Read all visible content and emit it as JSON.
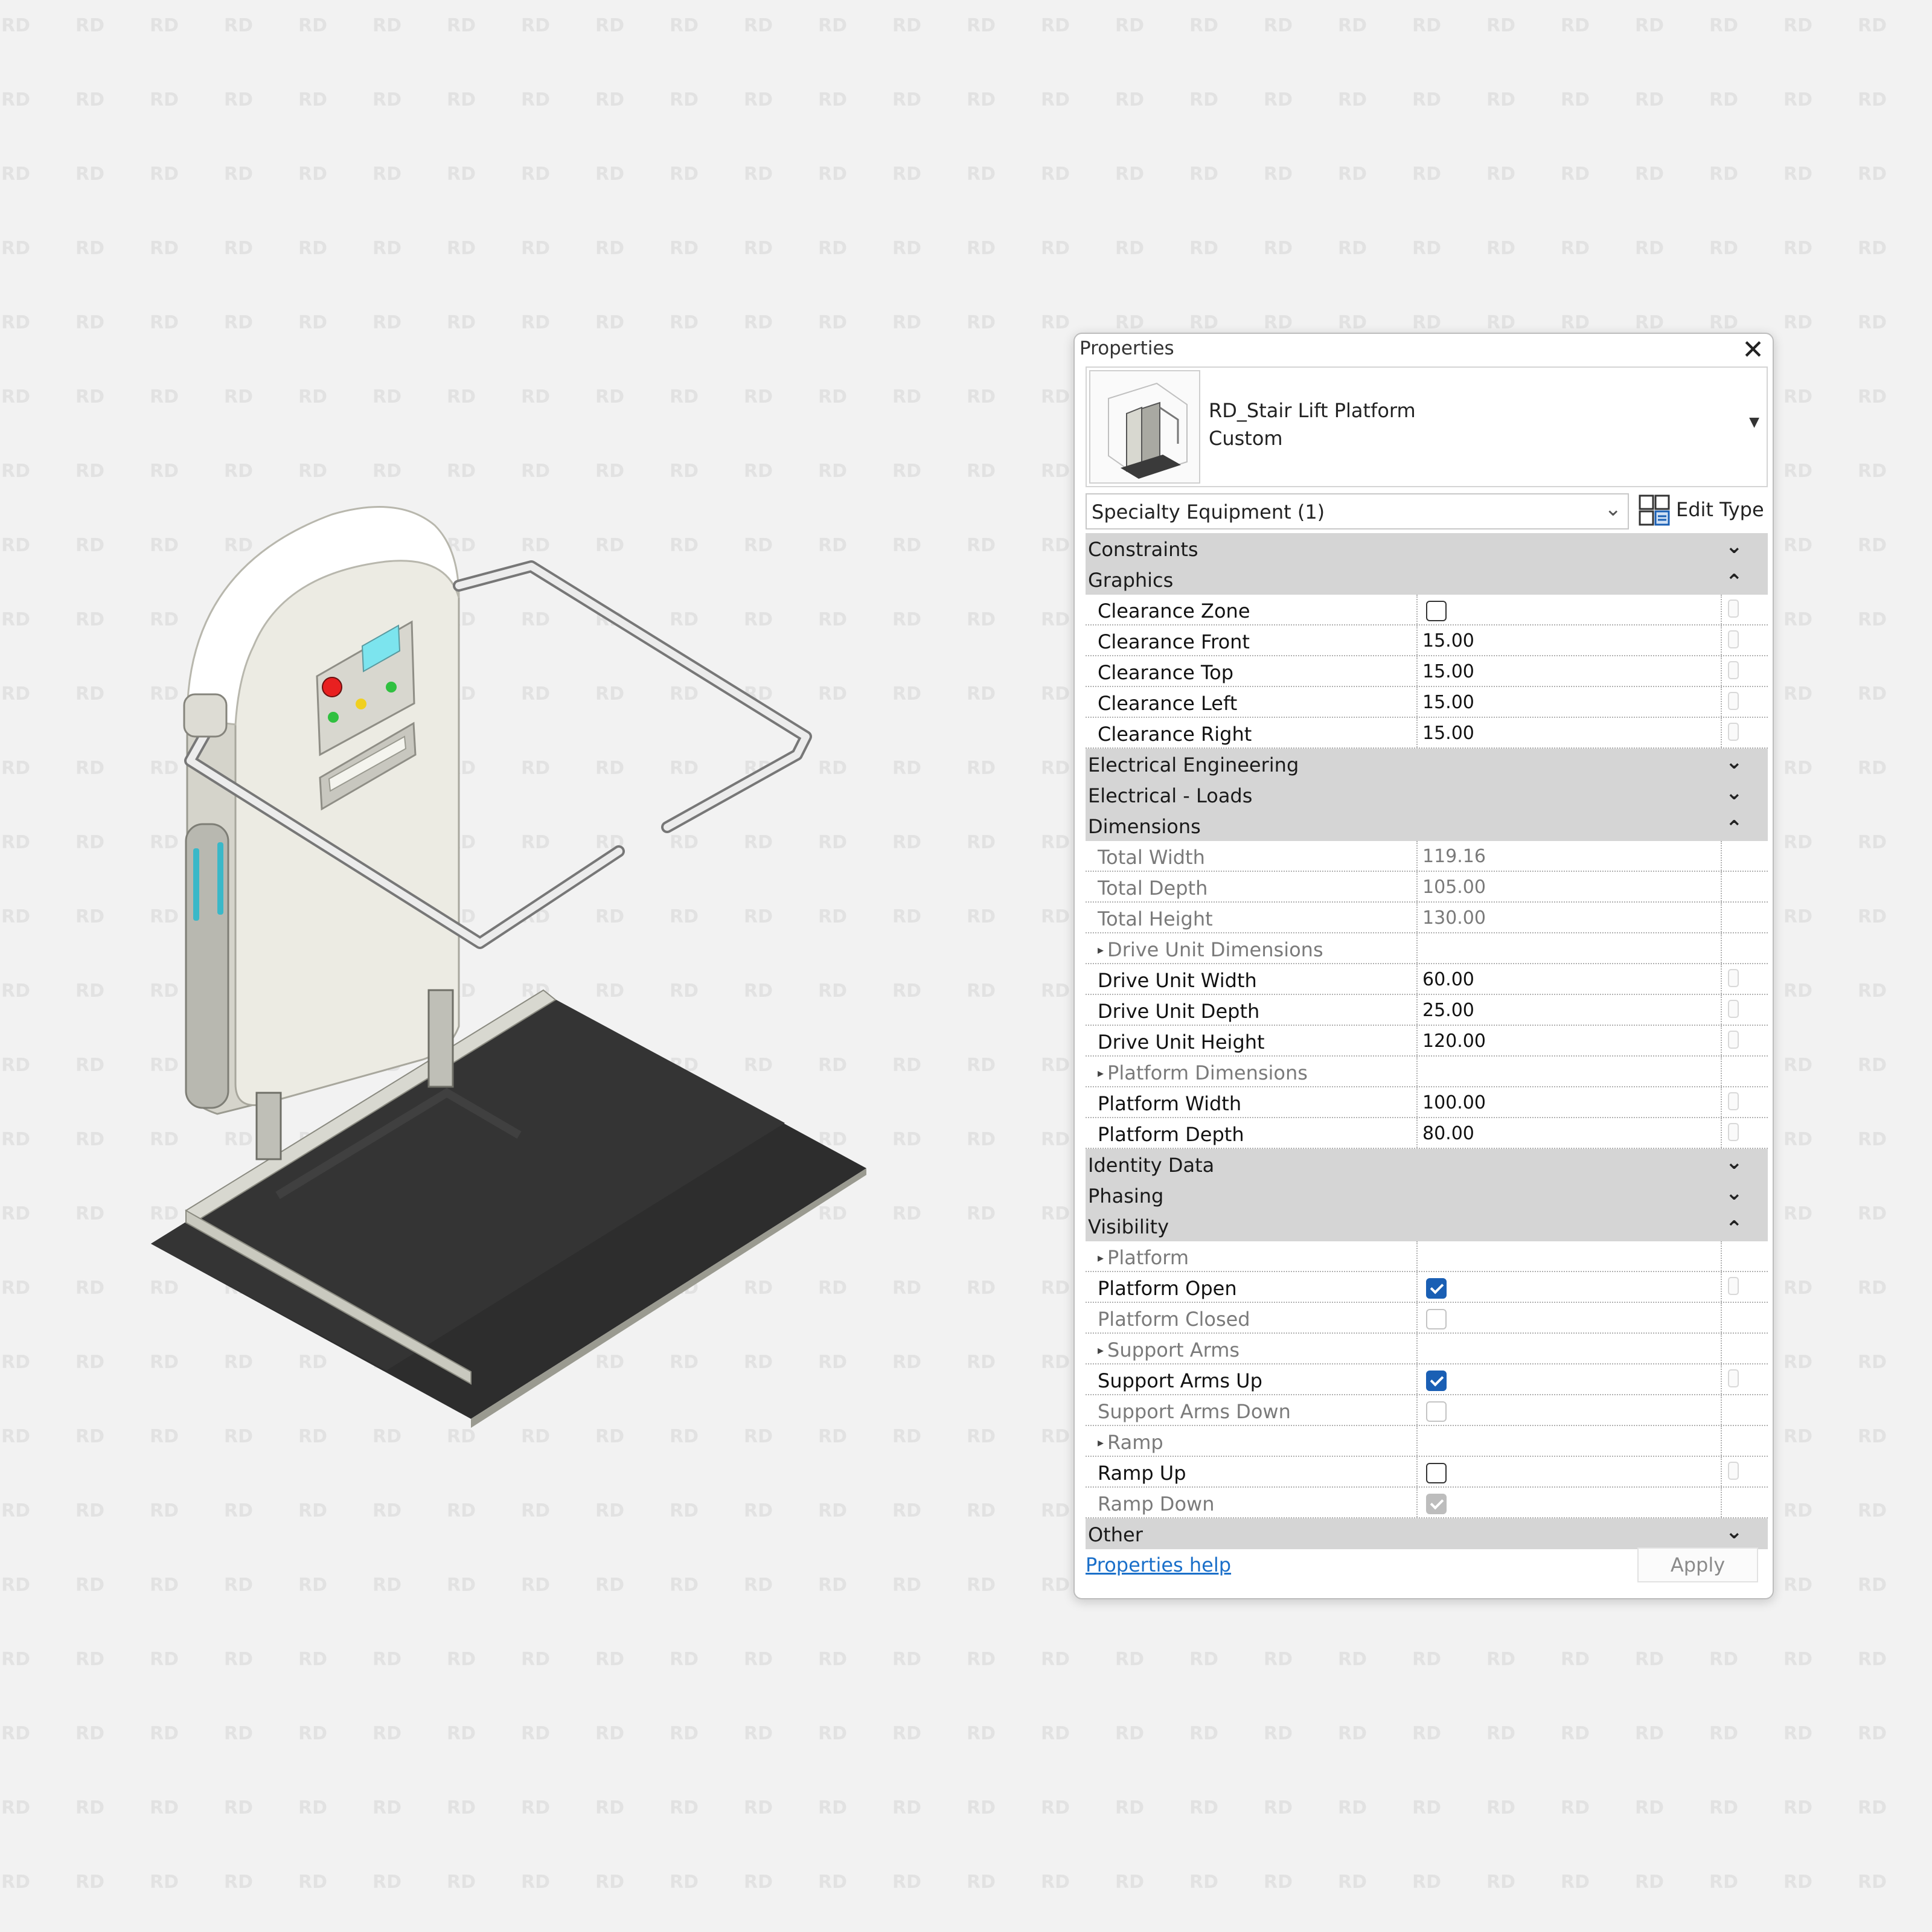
{
  "panel": {
    "title": "Properties",
    "type_name_line1": "RD_Stair Lift Platform",
    "type_name_line2": "Custom",
    "category_selector": "Specialty Equipment (1)",
    "edit_type_label": "Edit Type",
    "help_link": "Properties help",
    "apply_label": "Apply"
  },
  "rows": [
    {
      "kind": "section",
      "label": "Constraints",
      "state": "collapsed"
    },
    {
      "kind": "section",
      "label": "Graphics",
      "state": "expanded"
    },
    {
      "kind": "prop",
      "label": "Clearance Zone",
      "type": "checkbox",
      "checked": false
    },
    {
      "kind": "prop",
      "label": "Clearance Front",
      "value": "15.00"
    },
    {
      "kind": "prop",
      "label": "Clearance Top",
      "value": "15.00"
    },
    {
      "kind": "prop",
      "label": "Clearance Left",
      "value": "15.00"
    },
    {
      "kind": "prop",
      "label": "Clearance Right",
      "value": "15.00"
    },
    {
      "kind": "section",
      "label": "Electrical Engineering",
      "state": "collapsed"
    },
    {
      "kind": "section",
      "label": "Electrical - Loads",
      "state": "collapsed"
    },
    {
      "kind": "section",
      "label": "Dimensions",
      "state": "expanded"
    },
    {
      "kind": "prop",
      "label": "Total Width",
      "value": "119.16",
      "readonly": true
    },
    {
      "kind": "prop",
      "label": "Total Depth",
      "value": "105.00",
      "readonly": true
    },
    {
      "kind": "prop",
      "label": "Total Height",
      "value": "130.00",
      "readonly": true
    },
    {
      "kind": "prop",
      "label": "Drive Unit Dimensions",
      "group": true,
      "readonly": true
    },
    {
      "kind": "prop",
      "label": "Drive Unit Width",
      "value": "60.00"
    },
    {
      "kind": "prop",
      "label": "Drive Unit Depth",
      "value": "25.00"
    },
    {
      "kind": "prop",
      "label": "Drive Unit Height",
      "value": "120.00"
    },
    {
      "kind": "prop",
      "label": "Platform Dimensions",
      "group": true,
      "readonly": true
    },
    {
      "kind": "prop",
      "label": "Platform Width",
      "value": "100.00"
    },
    {
      "kind": "prop",
      "label": "Platform Depth",
      "value": "80.00"
    },
    {
      "kind": "section",
      "label": "Identity Data",
      "state": "collapsed"
    },
    {
      "kind": "section",
      "label": "Phasing",
      "state": "collapsed"
    },
    {
      "kind": "section",
      "label": "Visibility",
      "state": "expanded"
    },
    {
      "kind": "prop",
      "label": "Platform",
      "group": true,
      "readonly": true
    },
    {
      "kind": "prop",
      "label": "Platform Open",
      "type": "checkbox",
      "checked": true
    },
    {
      "kind": "prop",
      "label": "Platform Closed",
      "type": "checkbox",
      "checked": false,
      "readonly": true
    },
    {
      "kind": "prop",
      "label": "Support Arms",
      "group": true,
      "readonly": true
    },
    {
      "kind": "prop",
      "label": "Support Arms Up",
      "type": "checkbox",
      "checked": true
    },
    {
      "kind": "prop",
      "label": "Support Arms Down",
      "type": "checkbox",
      "checked": false,
      "readonly": true
    },
    {
      "kind": "prop",
      "label": "Ramp",
      "group": true,
      "readonly": true
    },
    {
      "kind": "prop",
      "label": "Ramp Up",
      "type": "checkbox",
      "checked": false
    },
    {
      "kind": "prop",
      "label": "Ramp Down",
      "type": "checkbox",
      "checked": true,
      "readonly": true
    },
    {
      "kind": "section",
      "label": "Other",
      "state": "collapsed"
    }
  ],
  "icons": {
    "close": "close-icon",
    "type_dropdown": "dropdown-arrow-icon",
    "category_dropdown": "chevron-down-icon",
    "edit_type": "edit-type-icon",
    "collapse": "double-chevron-up-icon",
    "expand": "double-chevron-down-icon",
    "group": "triangle-right-icon"
  },
  "watermark_text": "RD",
  "colors": {
    "background": "#f2f2f2",
    "panel": "#ffffff",
    "section_header": "#d5d5d5",
    "checkbox_checked": "#1a5fb4",
    "link": "#1a6fc9",
    "watermark": "#e2e2e2"
  }
}
